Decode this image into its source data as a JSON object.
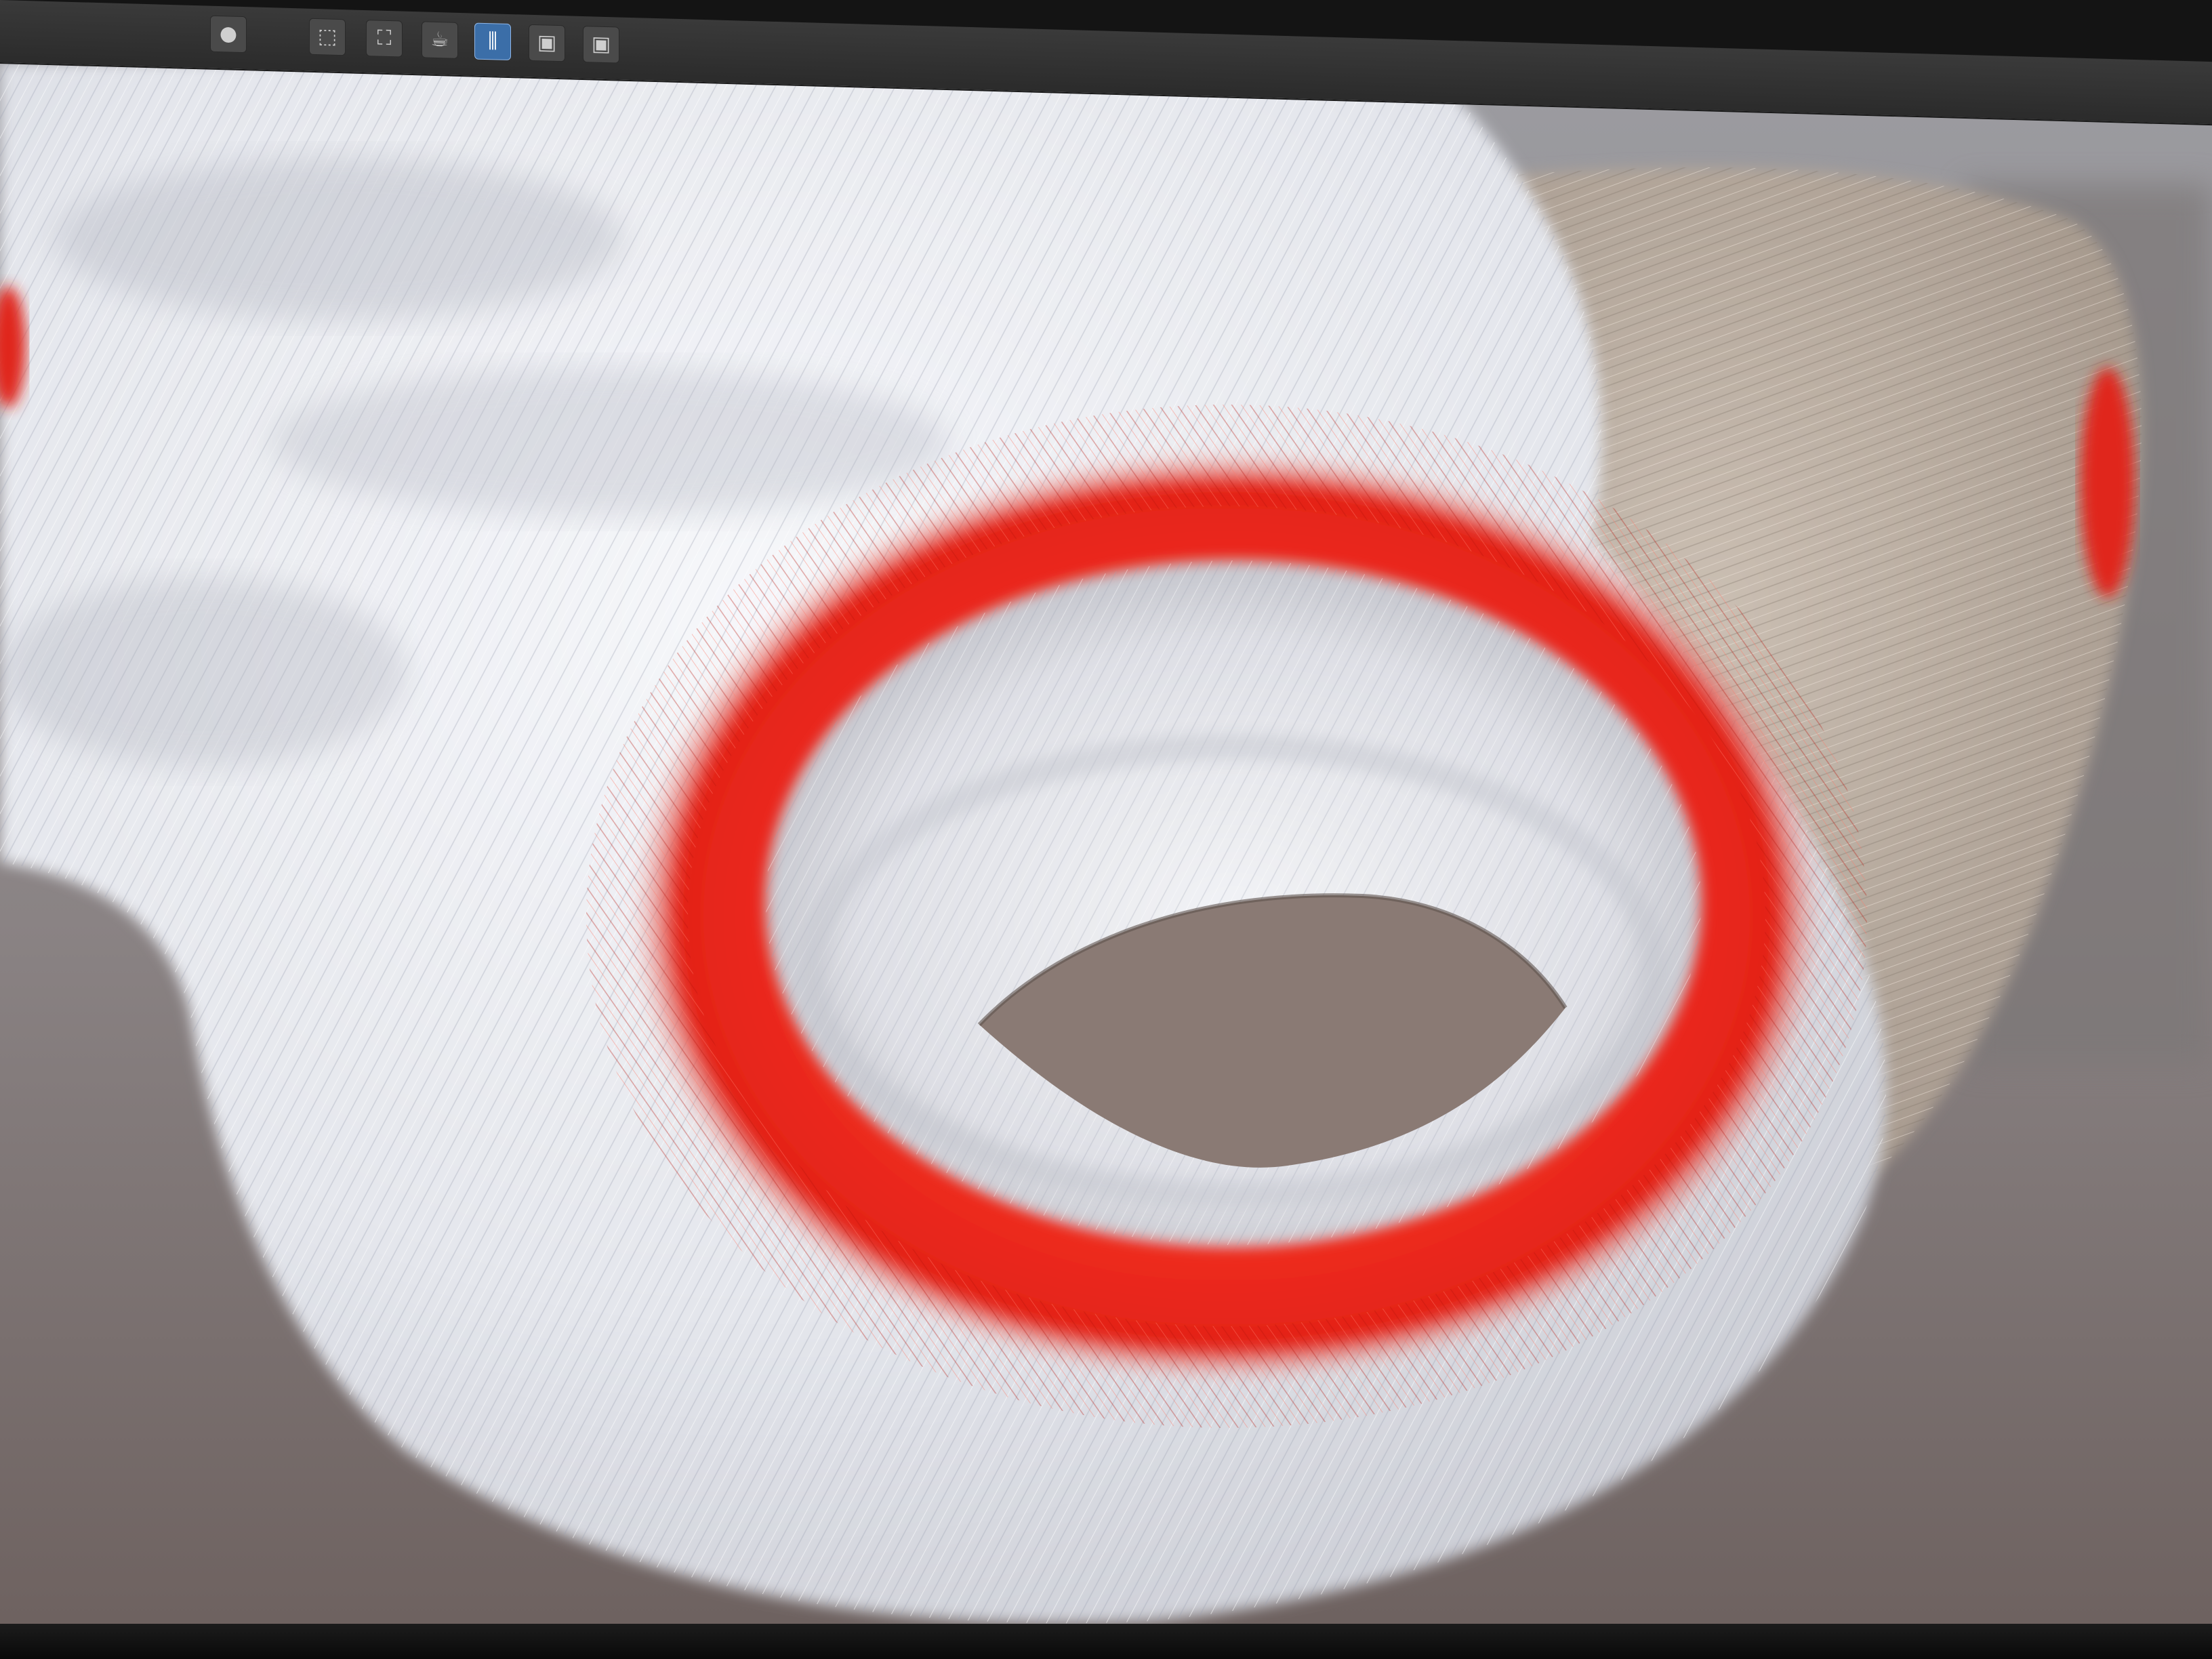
{
  "app": {
    "title": ""
  },
  "toolbar": {
    "items": [
      {
        "name": "sphere-tool-icon",
        "glyph": "●"
      },
      {
        "name": "select-region-icon",
        "glyph": "⬚"
      },
      {
        "name": "hierarchy-icon",
        "glyph": "⛶"
      },
      {
        "name": "teapot-render-icon",
        "glyph": "☕"
      },
      {
        "name": "hair-fur-modifier-icon",
        "glyph": "⫼",
        "active": true
      },
      {
        "name": "render-frame-icon",
        "glyph": "▣"
      },
      {
        "name": "render-preview-icon",
        "glyph": "▣"
      }
    ]
  },
  "viewport": {
    "content": "hair-fur-render",
    "colors": {
      "background_top": "#9a9a9d",
      "background_bottom": "#7a6e6b",
      "fur_white": "#eceef2",
      "fur_shadow": "#a9aab3",
      "fur_red": "#ee2b1f",
      "fur_beige": "#b6a89a",
      "hole": "#8a7a74"
    }
  }
}
